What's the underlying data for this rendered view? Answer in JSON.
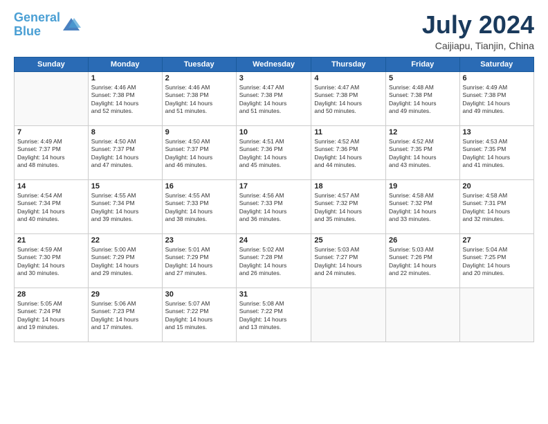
{
  "logo": {
    "line1": "General",
    "line2": "Blue"
  },
  "title": {
    "month_year": "July 2024",
    "location": "Caijiapu, Tianjin, China"
  },
  "header_days": [
    "Sunday",
    "Monday",
    "Tuesday",
    "Wednesday",
    "Thursday",
    "Friday",
    "Saturday"
  ],
  "weeks": [
    [
      {
        "day": "",
        "info": ""
      },
      {
        "day": "1",
        "info": "Sunrise: 4:46 AM\nSunset: 7:38 PM\nDaylight: 14 hours\nand 52 minutes."
      },
      {
        "day": "2",
        "info": "Sunrise: 4:46 AM\nSunset: 7:38 PM\nDaylight: 14 hours\nand 51 minutes."
      },
      {
        "day": "3",
        "info": "Sunrise: 4:47 AM\nSunset: 7:38 PM\nDaylight: 14 hours\nand 51 minutes."
      },
      {
        "day": "4",
        "info": "Sunrise: 4:47 AM\nSunset: 7:38 PM\nDaylight: 14 hours\nand 50 minutes."
      },
      {
        "day": "5",
        "info": "Sunrise: 4:48 AM\nSunset: 7:38 PM\nDaylight: 14 hours\nand 49 minutes."
      },
      {
        "day": "6",
        "info": "Sunrise: 4:49 AM\nSunset: 7:38 PM\nDaylight: 14 hours\nand 49 minutes."
      }
    ],
    [
      {
        "day": "7",
        "info": "Sunrise: 4:49 AM\nSunset: 7:37 PM\nDaylight: 14 hours\nand 48 minutes."
      },
      {
        "day": "8",
        "info": "Sunrise: 4:50 AM\nSunset: 7:37 PM\nDaylight: 14 hours\nand 47 minutes."
      },
      {
        "day": "9",
        "info": "Sunrise: 4:50 AM\nSunset: 7:37 PM\nDaylight: 14 hours\nand 46 minutes."
      },
      {
        "day": "10",
        "info": "Sunrise: 4:51 AM\nSunset: 7:36 PM\nDaylight: 14 hours\nand 45 minutes."
      },
      {
        "day": "11",
        "info": "Sunrise: 4:52 AM\nSunset: 7:36 PM\nDaylight: 14 hours\nand 44 minutes."
      },
      {
        "day": "12",
        "info": "Sunrise: 4:52 AM\nSunset: 7:35 PM\nDaylight: 14 hours\nand 43 minutes."
      },
      {
        "day": "13",
        "info": "Sunrise: 4:53 AM\nSunset: 7:35 PM\nDaylight: 14 hours\nand 41 minutes."
      }
    ],
    [
      {
        "day": "14",
        "info": "Sunrise: 4:54 AM\nSunset: 7:34 PM\nDaylight: 14 hours\nand 40 minutes."
      },
      {
        "day": "15",
        "info": "Sunrise: 4:55 AM\nSunset: 7:34 PM\nDaylight: 14 hours\nand 39 minutes."
      },
      {
        "day": "16",
        "info": "Sunrise: 4:55 AM\nSunset: 7:33 PM\nDaylight: 14 hours\nand 38 minutes."
      },
      {
        "day": "17",
        "info": "Sunrise: 4:56 AM\nSunset: 7:33 PM\nDaylight: 14 hours\nand 36 minutes."
      },
      {
        "day": "18",
        "info": "Sunrise: 4:57 AM\nSunset: 7:32 PM\nDaylight: 14 hours\nand 35 minutes."
      },
      {
        "day": "19",
        "info": "Sunrise: 4:58 AM\nSunset: 7:32 PM\nDaylight: 14 hours\nand 33 minutes."
      },
      {
        "day": "20",
        "info": "Sunrise: 4:58 AM\nSunset: 7:31 PM\nDaylight: 14 hours\nand 32 minutes."
      }
    ],
    [
      {
        "day": "21",
        "info": "Sunrise: 4:59 AM\nSunset: 7:30 PM\nDaylight: 14 hours\nand 30 minutes."
      },
      {
        "day": "22",
        "info": "Sunrise: 5:00 AM\nSunset: 7:29 PM\nDaylight: 14 hours\nand 29 minutes."
      },
      {
        "day": "23",
        "info": "Sunrise: 5:01 AM\nSunset: 7:29 PM\nDaylight: 14 hours\nand 27 minutes."
      },
      {
        "day": "24",
        "info": "Sunrise: 5:02 AM\nSunset: 7:28 PM\nDaylight: 14 hours\nand 26 minutes."
      },
      {
        "day": "25",
        "info": "Sunrise: 5:03 AM\nSunset: 7:27 PM\nDaylight: 14 hours\nand 24 minutes."
      },
      {
        "day": "26",
        "info": "Sunrise: 5:03 AM\nSunset: 7:26 PM\nDaylight: 14 hours\nand 22 minutes."
      },
      {
        "day": "27",
        "info": "Sunrise: 5:04 AM\nSunset: 7:25 PM\nDaylight: 14 hours\nand 20 minutes."
      }
    ],
    [
      {
        "day": "28",
        "info": "Sunrise: 5:05 AM\nSunset: 7:24 PM\nDaylight: 14 hours\nand 19 minutes."
      },
      {
        "day": "29",
        "info": "Sunrise: 5:06 AM\nSunset: 7:23 PM\nDaylight: 14 hours\nand 17 minutes."
      },
      {
        "day": "30",
        "info": "Sunrise: 5:07 AM\nSunset: 7:22 PM\nDaylight: 14 hours\nand 15 minutes."
      },
      {
        "day": "31",
        "info": "Sunrise: 5:08 AM\nSunset: 7:22 PM\nDaylight: 14 hours\nand 13 minutes."
      },
      {
        "day": "",
        "info": ""
      },
      {
        "day": "",
        "info": ""
      },
      {
        "day": "",
        "info": ""
      }
    ]
  ]
}
